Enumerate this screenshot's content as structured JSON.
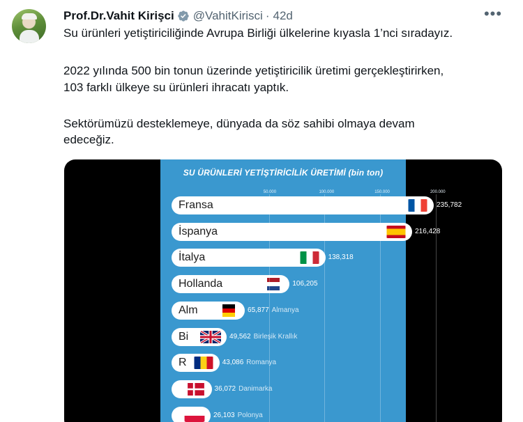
{
  "tweet": {
    "author_name": "Prof.Dr.Vahit Kirişci",
    "handle": "@VahitKirisci",
    "separator": "·",
    "time": "42d",
    "more_icon": "more-dots-icon",
    "verified_icon": "verified-badge-icon",
    "verified_color": "#829aab",
    "lines": [
      "Su ürünleri yetiştiriciliğinde Avrupa Birliği ülkelerine kıyasla 1’nci sıradayız.",
      "2022 yılında 500 bin tonun üzerinde yetiştiricilik üretimi gerçekleştirirken,",
      "103 farklı ülkeye su ürünleri ihracatı yaptık.",
      "Sektörümüzü desteklemeye, dünyada da söz sahibi olmaya devam",
      "edeceğiz."
    ]
  },
  "chart_data": {
    "type": "bar",
    "title": "SU ÜRÜNLERİ YETİŞTİRİCİLİK ÜRETİMİ (bin ton)",
    "tick_labels": [
      "50.000",
      "100.000",
      "150.000",
      "200.000"
    ],
    "categories": [
      "Fransa",
      "İspanya",
      "İtalya",
      "Hollanda",
      "Almanya",
      "Birleşik Krallık",
      "Romanya",
      "Danimarka",
      "Polonya"
    ],
    "bar_labels": [
      "Fransa",
      "İspanya",
      "İtalya",
      "Hollanda",
      "Alm",
      "Bi",
      "R",
      "",
      ""
    ],
    "side_labels": [
      "",
      "",
      "",
      "",
      "Almanya",
      "Birleşik Krallık",
      "Romanya",
      "Danimarka",
      "Polonya"
    ],
    "value_labels": [
      "235,782",
      "216,428",
      "138,318",
      "106,205",
      "65,877",
      "49,562",
      "43,086",
      "36,072",
      "26,103"
    ],
    "values": [
      235782,
      216428,
      138318,
      106205,
      65877,
      49562,
      43086,
      36072,
      26103
    ],
    "flags": [
      "france-flag-icon",
      "spain-flag-icon",
      "italy-flag-icon",
      "netherlands-flag-icon",
      "germany-flag-icon",
      "uk-flag-icon",
      "romania-flag-icon",
      "denmark-flag-icon",
      "poland-flag-icon"
    ],
    "background_color": "#3a98cf",
    "bar_color": "#ffffff"
  }
}
